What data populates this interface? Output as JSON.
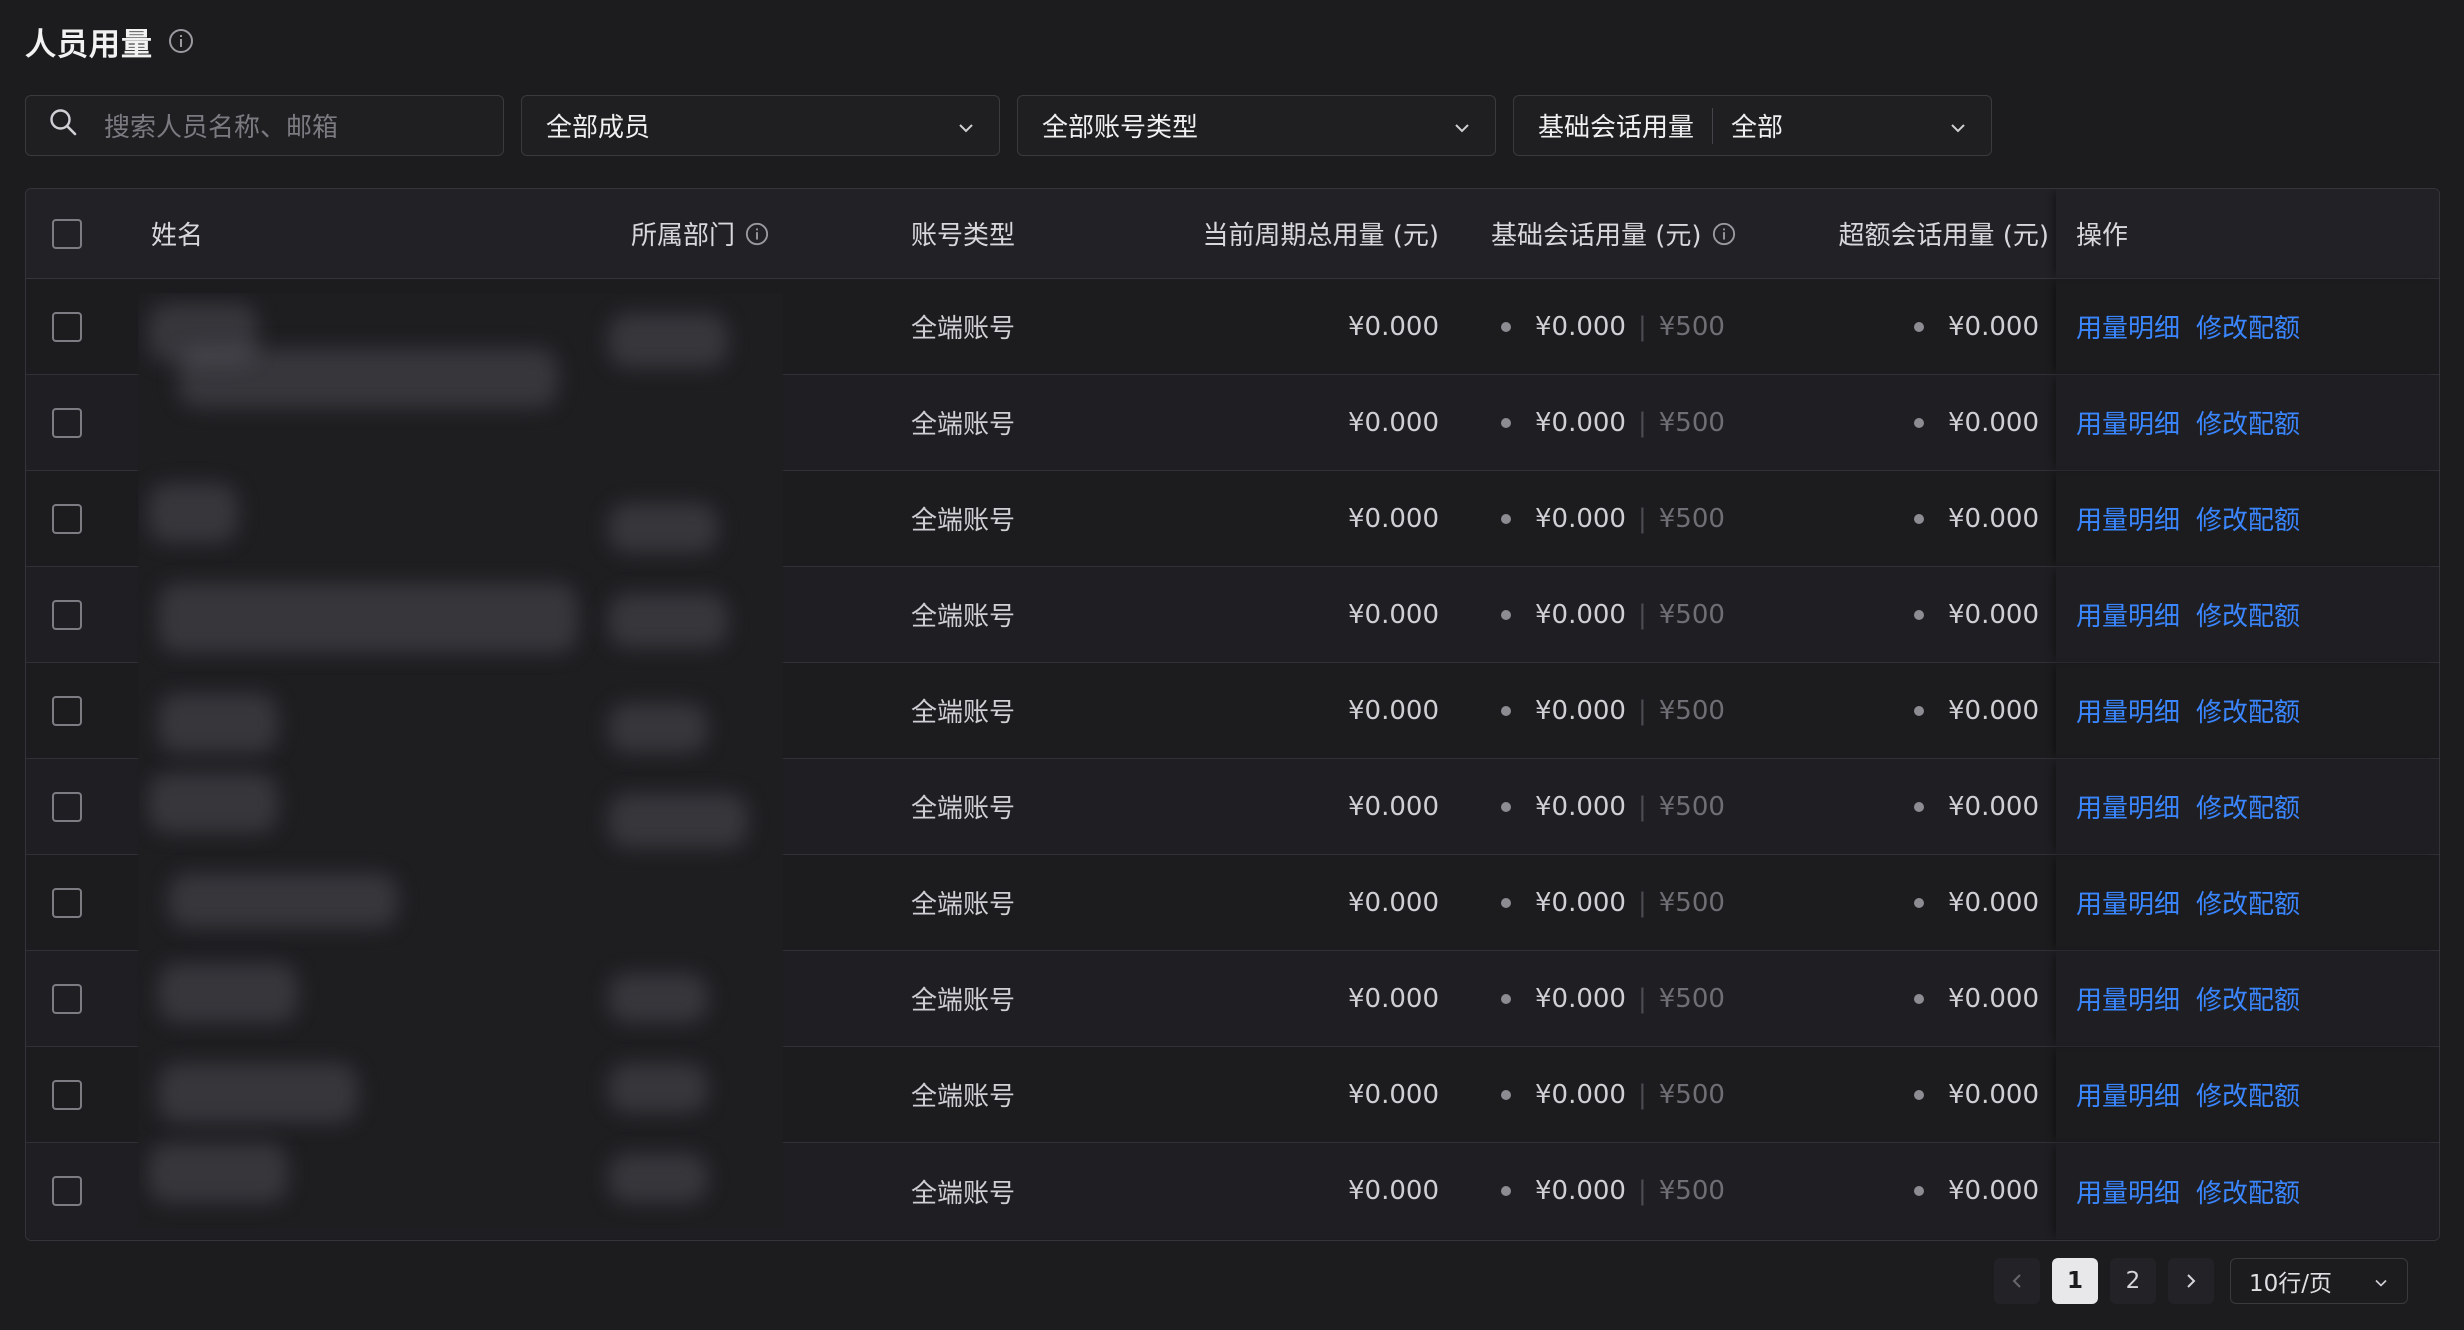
{
  "header": {
    "title": "人员用量"
  },
  "filters": {
    "search_placeholder": "搜索人员名称、邮箱",
    "members_select": "全部成员",
    "account_type_select": "全部账号类型",
    "base_usage_label": "基础会话用量",
    "base_usage_value": "全部"
  },
  "table": {
    "columns": {
      "name": "姓名",
      "dept": "所属部门",
      "type": "账号类型",
      "total": "当前周期总用量 (元)",
      "base": "基础会话用量 (元)",
      "extra": "超额会话用量 (元)",
      "ops": "操作"
    },
    "rows": [
      {
        "type": "全端账号",
        "total": "¥0.000",
        "base": "¥0.000",
        "quota": "¥500",
        "extra": "¥0.000",
        "op1": "用量明细",
        "op2": "修改配额"
      },
      {
        "type": "全端账号",
        "total": "¥0.000",
        "base": "¥0.000",
        "quota": "¥500",
        "extra": "¥0.000",
        "op1": "用量明细",
        "op2": "修改配额"
      },
      {
        "type": "全端账号",
        "total": "¥0.000",
        "base": "¥0.000",
        "quota": "¥500",
        "extra": "¥0.000",
        "op1": "用量明细",
        "op2": "修改配额"
      },
      {
        "type": "全端账号",
        "total": "¥0.000",
        "base": "¥0.000",
        "quota": "¥500",
        "extra": "¥0.000",
        "op1": "用量明细",
        "op2": "修改配额"
      },
      {
        "type": "全端账号",
        "total": "¥0.000",
        "base": "¥0.000",
        "quota": "¥500",
        "extra": "¥0.000",
        "op1": "用量明细",
        "op2": "修改配额"
      },
      {
        "type": "全端账号",
        "total": "¥0.000",
        "base": "¥0.000",
        "quota": "¥500",
        "extra": "¥0.000",
        "op1": "用量明细",
        "op2": "修改配额"
      },
      {
        "type": "全端账号",
        "total": "¥0.000",
        "base": "¥0.000",
        "quota": "¥500",
        "extra": "¥0.000",
        "op1": "用量明细",
        "op2": "修改配额"
      },
      {
        "type": "全端账号",
        "total": "¥0.000",
        "base": "¥0.000",
        "quota": "¥500",
        "extra": "¥0.000",
        "op1": "用量明细",
        "op2": "修改配额"
      },
      {
        "type": "全端账号",
        "total": "¥0.000",
        "base": "¥0.000",
        "quota": "¥500",
        "extra": "¥0.000",
        "op1": "用量明细",
        "op2": "修改配额"
      },
      {
        "type": "全端账号",
        "total": "¥0.000",
        "base": "¥0.000",
        "quota": "¥500",
        "extra": "¥0.000",
        "op1": "用量明细",
        "op2": "修改配额"
      }
    ]
  },
  "pagination": {
    "pages": [
      "1",
      "2"
    ],
    "current": "1",
    "page_size": "10行/页"
  }
}
